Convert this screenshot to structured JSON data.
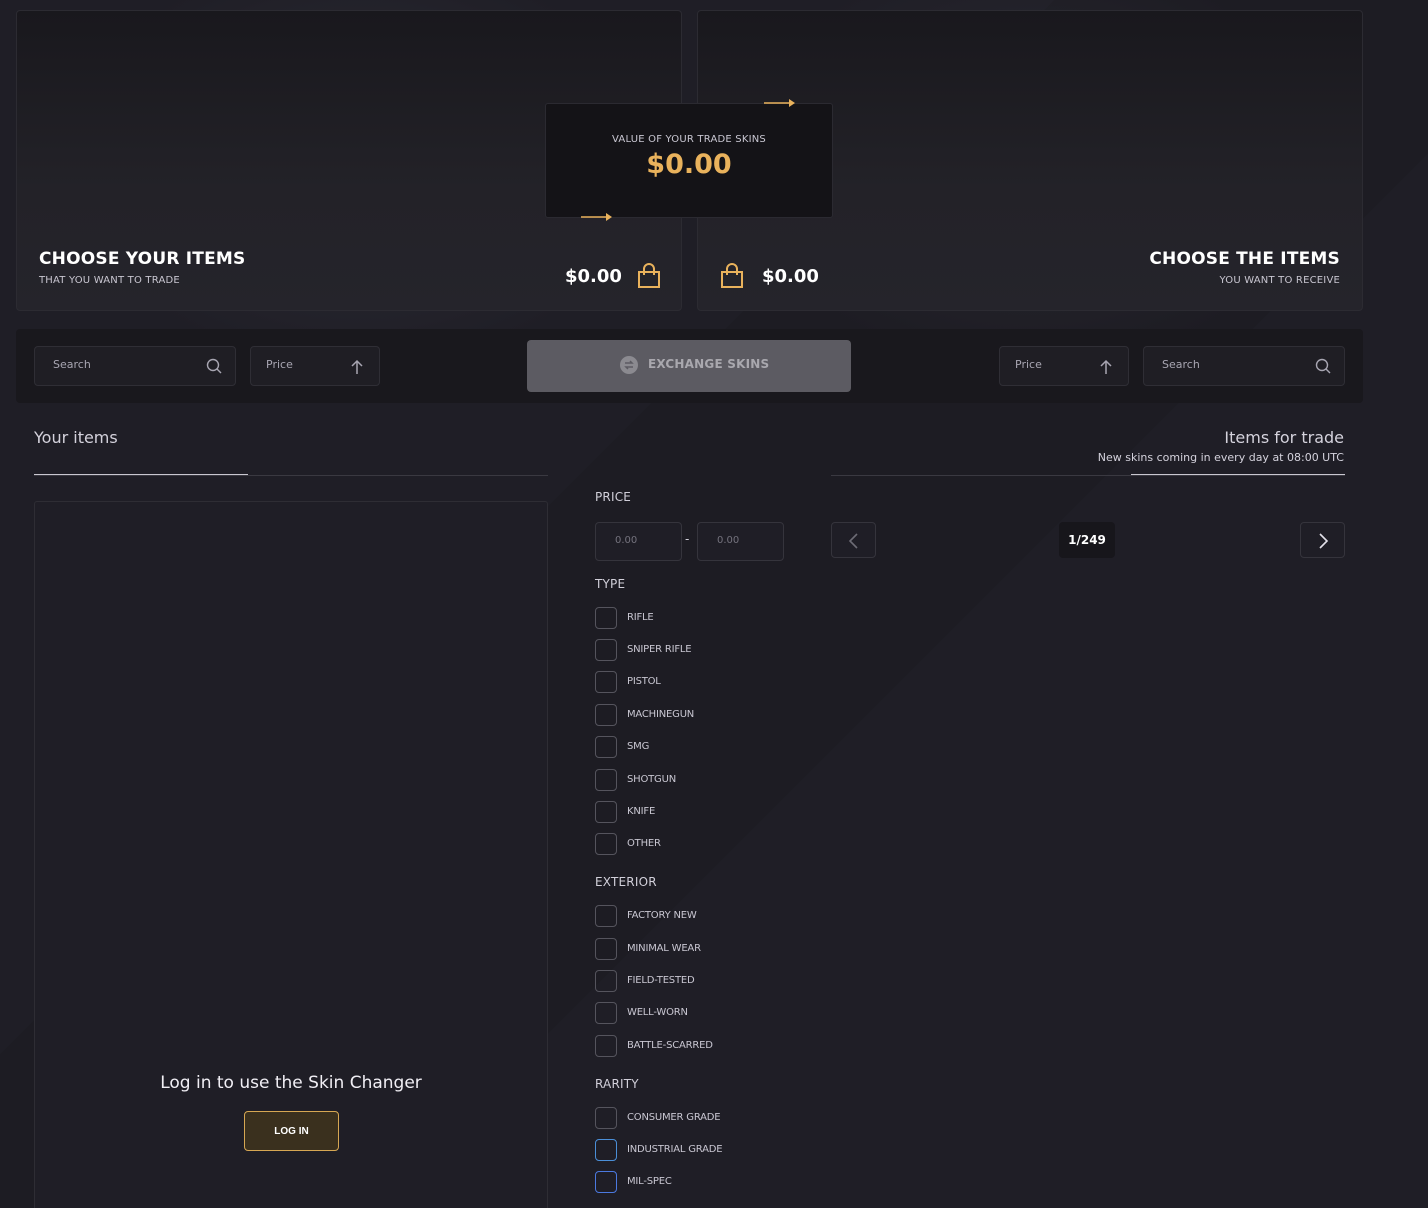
{
  "left_panel": {
    "title": "CHOOSE YOUR ITEMS",
    "subtitle": "THAT YOU WANT TO TRADE",
    "amount": "$0.00"
  },
  "right_panel": {
    "title": "CHOOSE THE ITEMS",
    "subtitle": "YOU WANT TO RECEIVE",
    "amount": "$0.00"
  },
  "value_box": {
    "label": "VALUE OF YOUR TRADE SKINS",
    "amount": "$0.00"
  },
  "toolbar": {
    "left_search_placeholder": "Search",
    "left_price_label": "Price",
    "exchange_label": "EXCHANGE SKINS",
    "right_price_label": "Price",
    "right_search_placeholder": "Search"
  },
  "your_items": {
    "title": "Your items",
    "login_message": "Log in to use the Skin Changer",
    "login_button": "LOG IN"
  },
  "items_for_trade": {
    "title": "Items for trade",
    "note": "New skins coming in every day at 08:00 UTC"
  },
  "filters": {
    "price": {
      "heading": "PRICE",
      "min_placeholder": "0.00",
      "max_placeholder": "0.00",
      "separator": "-"
    },
    "type": {
      "heading": "TYPE",
      "options": [
        "RIFLE",
        "SNIPER RIFLE",
        "PISTOL",
        "MACHINEGUN",
        "SMG",
        "SHOTGUN",
        "KNIFE",
        "OTHER"
      ]
    },
    "exterior": {
      "heading": "EXTERIOR",
      "options": [
        "FACTORY NEW",
        "MINIMAL WEAR",
        "FIELD-TESTED",
        "WELL-WORN",
        "BATTLE-SCARRED"
      ]
    },
    "rarity": {
      "heading": "RARITY",
      "options": [
        {
          "label": "CONSUMER GRADE",
          "color": "#55545d"
        },
        {
          "label": "INDUSTRIAL GRADE",
          "color": "#4b8fd8"
        },
        {
          "label": "MIL-SPEC",
          "color": "#4b79e0"
        }
      ]
    }
  },
  "pagination": {
    "indicator": "1/249"
  },
  "colors": {
    "accent": "#e9b25c",
    "background": "#1f1e26",
    "panel": "#19181d"
  },
  "icons": {
    "bag": "shopping-bag-icon",
    "search": "search-icon",
    "sort": "arrow-up-icon",
    "exchange": "exchange-icon",
    "prev": "chevron-left-icon",
    "next": "chevron-right-icon",
    "arrow": "arrow-right-icon"
  }
}
